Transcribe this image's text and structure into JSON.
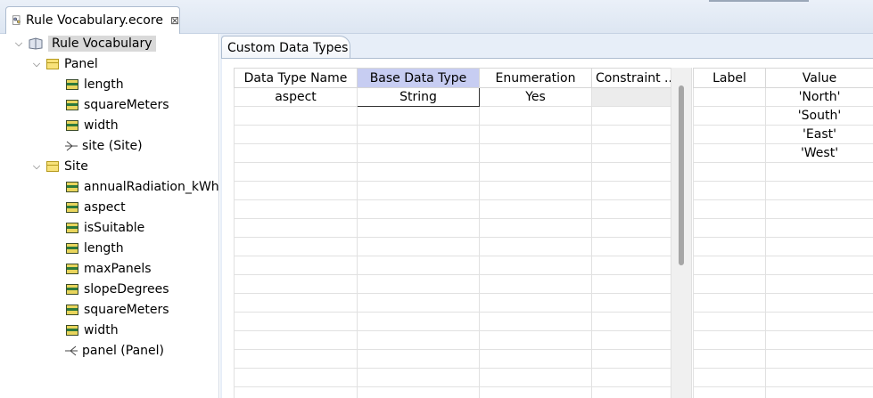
{
  "editor_tab": {
    "title": "Rule Vocabulary.ecore",
    "close": "⊠"
  },
  "tree": {
    "root": "Rule Vocabulary",
    "panel": {
      "label": "Panel",
      "items": [
        "length",
        "squareMeters",
        "width"
      ],
      "ref": "site (Site)"
    },
    "site": {
      "label": "Site",
      "items": [
        "annualRadiation_kWh",
        "aspect",
        "isSuitable",
        "length",
        "maxPanels",
        "slopeDegrees",
        "squareMeters",
        "width"
      ],
      "ref": "panel (Panel)"
    }
  },
  "section_tab": "Custom Data Types",
  "types_table": {
    "headers": [
      "Data Type Name",
      "Base Data Type",
      "Enumeration",
      "Constraint ..."
    ],
    "rows": [
      [
        "aspect",
        "String",
        "Yes",
        ""
      ]
    ]
  },
  "enum_table": {
    "headers": [
      "Label",
      "Value"
    ],
    "rows": [
      [
        "",
        "'North'"
      ],
      [
        "",
        "'South'"
      ],
      [
        "",
        "'East'"
      ],
      [
        "",
        "'West'"
      ]
    ]
  },
  "colors": {
    "sorted_header": "#c7cdf2",
    "tab_bg": "#e7eef8"
  }
}
